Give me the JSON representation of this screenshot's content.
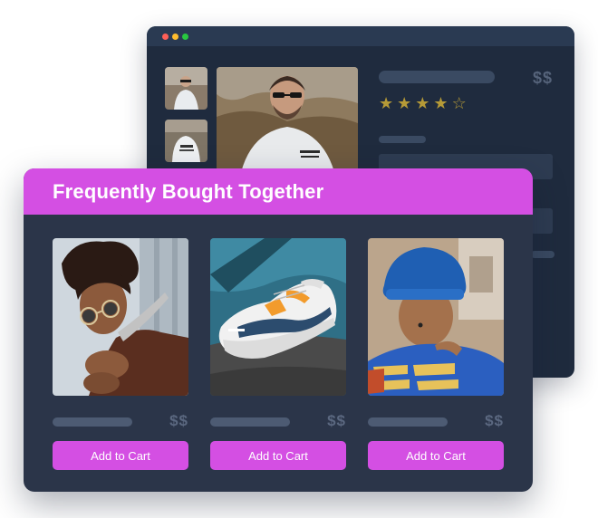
{
  "product_page": {
    "price": "$$",
    "rating": {
      "value": 4,
      "max": 5
    },
    "stars": [
      "★",
      "★",
      "★",
      "★",
      "☆"
    ]
  },
  "widget": {
    "title": "Frequently Bought Together",
    "products": [
      {
        "photo": "man-with-sunglasses-photo",
        "price": "$$",
        "button_label": "Add to Cart"
      },
      {
        "photo": "sneaker-photo",
        "price": "$$",
        "button_label": "Add to Cart"
      },
      {
        "photo": "blue-beanie-man-photo",
        "price": "$$",
        "button_label": "Add to Cart"
      }
    ]
  },
  "colors": {
    "accent": "#d44fe3",
    "back_window": "#1f2b3e",
    "front_card": "#2b3549",
    "star": "#b59a37"
  }
}
